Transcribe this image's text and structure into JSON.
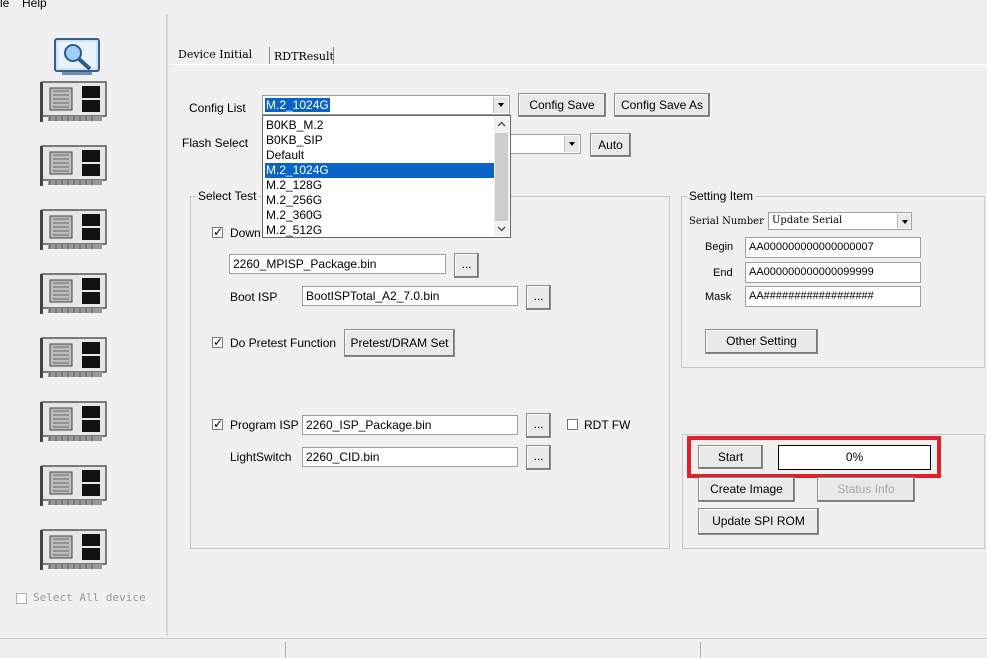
{
  "menu": {
    "file": "le",
    "help": "Help"
  },
  "tabs": [
    {
      "label": "Device Initial"
    },
    {
      "label": "RDTResult"
    }
  ],
  "config": {
    "label": "Config List",
    "value": "M.2_1024G",
    "save_label": "Config Save",
    "save_as_label": "Config Save As",
    "options": [
      "B0KB_M.2",
      "B0KB_SIP",
      "Default",
      "M.2_1024G",
      "M.2_128G",
      "M.2_256G",
      "M.2_360G",
      "M.2_512G"
    ],
    "selected_index": 3
  },
  "flash": {
    "label": "Flash Select",
    "auto_label": "Auto"
  },
  "select_test": {
    "title": "Select Test",
    "download_label": "Down",
    "download_file": "2260_MPISP_Package.bin",
    "boot_isp_label": "Boot ISP",
    "boot_isp_file": "BootISPTotal_A2_7.0.bin",
    "pretest_label": "Do Pretest Function",
    "pretest_button": "Pretest/DRAM Set",
    "program_isp_label": "Program ISP",
    "program_isp_file": "2260_ISP_Package.bin",
    "rdt_fw_label": "RDT FW",
    "lightswitch_label": "LightSwitch",
    "lightswitch_file": "2260_CID.bin",
    "browse": "..."
  },
  "setting_item": {
    "title": "Setting Item",
    "serial_label": "Serial Number",
    "serial_value": "Update Serial",
    "begin_label": "Begin",
    "begin_value": "AA000000000000000007",
    "end_label": "End",
    "end_value": "AA000000000000099999",
    "mask_label": "Mask",
    "mask_value": "AA##################",
    "other_setting": "Other Setting"
  },
  "actions": {
    "start": "Start",
    "progress_text": "0%",
    "progress": 0,
    "create_image": "Create Image",
    "status_info": "Status Info",
    "update_spi": "Update SPI ROM"
  },
  "device_panel": {
    "select_all": "Select All device"
  },
  "colors": {
    "highlight_border": "#e0202a",
    "selection": "#0a64c8"
  }
}
